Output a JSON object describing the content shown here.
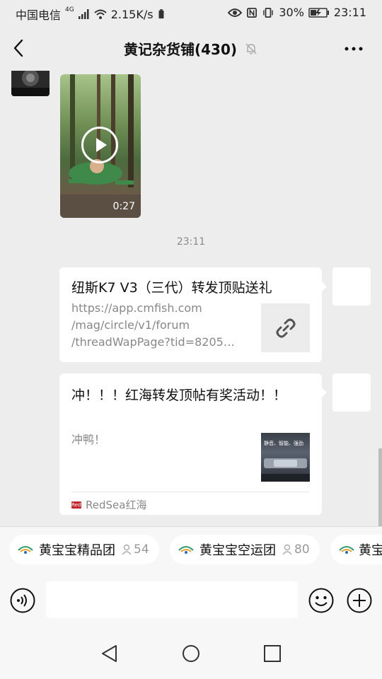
{
  "status_bar": {
    "carrier": "中国电信",
    "network_type": "4G",
    "speed": "2.15K/s",
    "battery": "30%",
    "time": "23:11"
  },
  "nav": {
    "title": "黄记杂货铺(430)",
    "muted_icon": "bell-off-icon"
  },
  "messages": {
    "video": {
      "duration": "0:27"
    },
    "timestamp": "23:11",
    "link_card": {
      "title": "纽斯K7 V3（三代）转发顶贴送礼",
      "url_lines": [
        "https://app.cmfish.com",
        "/mag/circle/v1/forum",
        "/threadWapPage?tid=8205…"
      ],
      "thumb_icon": "link-icon"
    },
    "article_card": {
      "title": "冲！！！红海转发顶帖有奖活动！！",
      "description": "冲鸭！",
      "thumb_caption": "静音、智能、强劲",
      "source_logo_text": "RedSea",
      "source": "RedSea红海"
    }
  },
  "shortcuts": [
    {
      "label": "黄宝宝精品团",
      "count": "54"
    },
    {
      "label": "黄宝宝空运团",
      "count": "80"
    },
    {
      "label": "黄宝"
    }
  ],
  "input": {
    "placeholder": ""
  },
  "colors": {
    "background": "#ededed",
    "bubble": "#ffffff",
    "bar": "#f7f7f7"
  }
}
